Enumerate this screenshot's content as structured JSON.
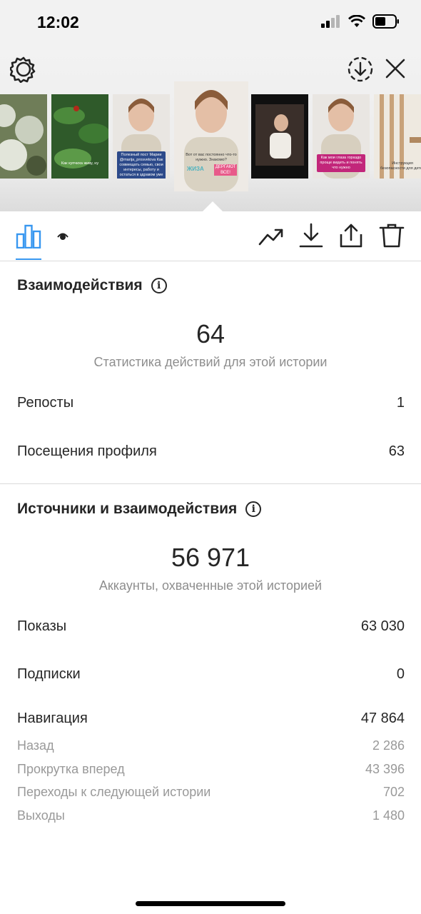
{
  "status_bar": {
    "time": "12:02"
  },
  "colors": {
    "accent": "#3897f0",
    "text": "#262626",
    "secondary": "#8e8e8e"
  },
  "header": {
    "icons": [
      "settings-icon",
      "save-to-archive-icon",
      "close-icon"
    ]
  },
  "thumbnails": [
    {
      "caption": ""
    },
    {
      "caption": "Как купчиха живу, ну"
    },
    {
      "caption": "Полезный пост Марии @marija_prosvetova Как совмещать семью, свои интересы, работу и остаться в здравом уме"
    },
    {
      "caption": "Вот от вас постоянно что-то нужно. Знакомо?",
      "stickers": [
        "ЖИЗА",
        "ДЕРГАЮТ ВСЕ!"
      ]
    },
    {
      "caption": ""
    },
    {
      "caption": "Как мои глаза гораздо проще видеть и понять что нужно"
    },
    {
      "caption": "Инструкция безопасности для детей"
    }
  ],
  "toolbar": {
    "tabs": [
      "insights-bar-chart-icon",
      "viewers-eye-icon"
    ],
    "actions": [
      "promote-trend-icon",
      "download-icon",
      "share-icon",
      "delete-trash-icon"
    ]
  },
  "interactions": {
    "title": "Взаимодействия",
    "total": "64",
    "caption": "Статистика действий для этой истории",
    "rows": [
      {
        "label": "Репосты",
        "value": "1"
      },
      {
        "label": "Посещения профиля",
        "value": "63"
      }
    ]
  },
  "reach": {
    "title": "Источники и взаимодействия",
    "total": "56 971",
    "caption": "Аккаунты, охваченные этой историей",
    "rows": [
      {
        "label": "Показы",
        "value": "63 030"
      },
      {
        "label": "Подписки",
        "value": "0"
      },
      {
        "label": "Навигация",
        "value": "47 864"
      }
    ],
    "navigation": [
      {
        "label": "Назад",
        "value": "2 286"
      },
      {
        "label": "Прокрутка вперед",
        "value": "43 396"
      },
      {
        "label": "Переходы к следующей истории",
        "value": "702"
      },
      {
        "label": "Выходы",
        "value": "1 480"
      }
    ]
  }
}
